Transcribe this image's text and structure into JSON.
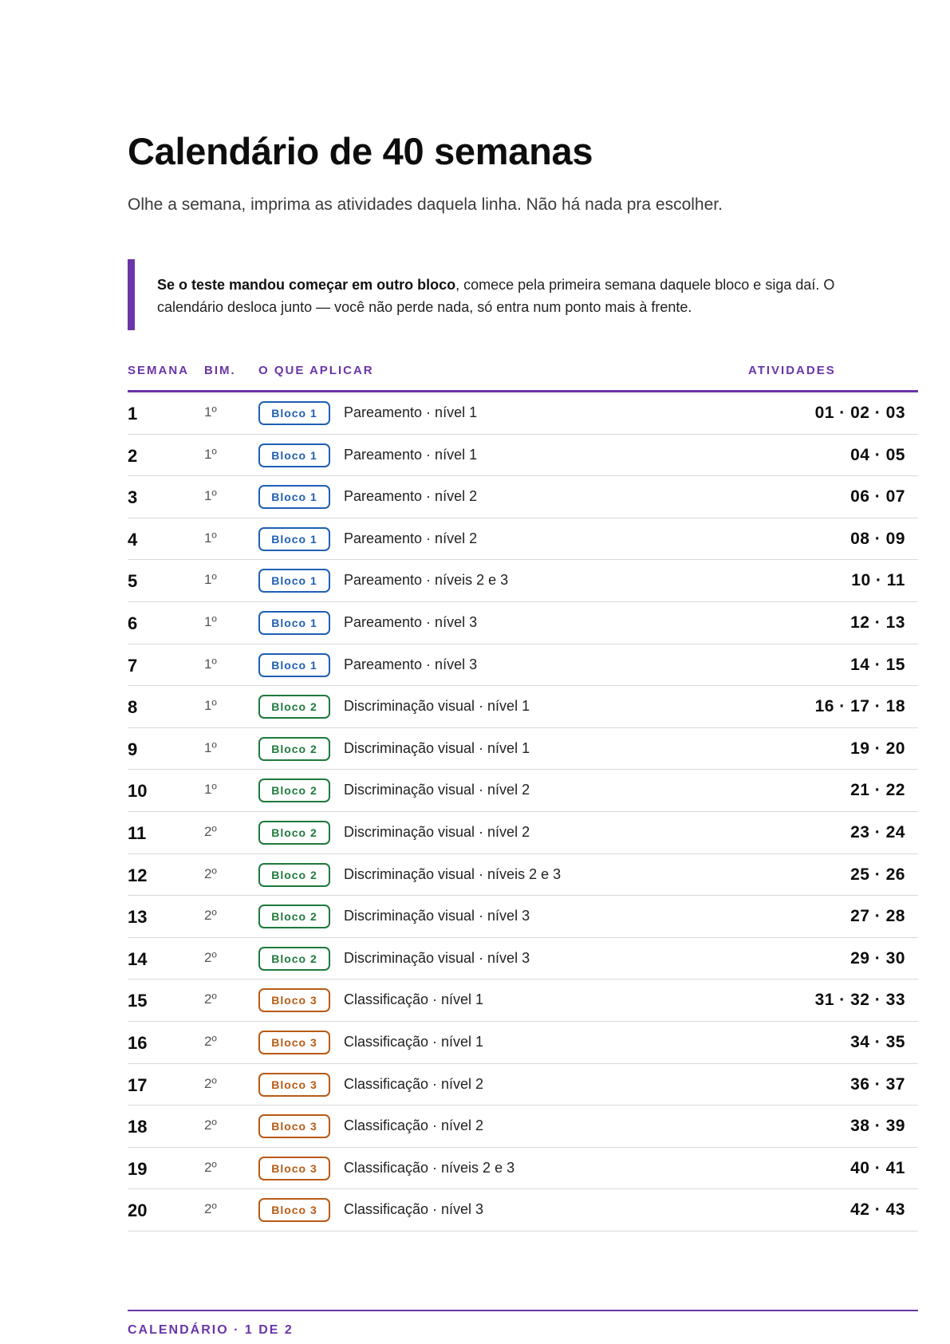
{
  "title": "Calendário de 40 semanas",
  "subtitle": "Olhe a semana, imprima as atividades daquela linha. Não há nada pra escolher.",
  "callout": {
    "bold": "Se o teste mandou começar em outro bloco",
    "text": ", comece pela primeira semana daquele bloco e siga daí. O calendário desloca junto — você não perde nada, só entra num ponto mais à frente."
  },
  "table": {
    "headers": {
      "week": "SEMANA",
      "bim": "BIM.",
      "apply": "O QUE APLICAR",
      "activities": "ATIVIDADES"
    },
    "rows": [
      {
        "week": "1",
        "bim": "1º",
        "block": "Bloco 1",
        "color": "#1f5fb3",
        "desc": "Pareamento · nível 1",
        "acts": "01 · 02 · 03"
      },
      {
        "week": "2",
        "bim": "1º",
        "block": "Bloco 1",
        "color": "#1f5fb3",
        "desc": "Pareamento · nível 1",
        "acts": "04 · 05"
      },
      {
        "week": "3",
        "bim": "1º",
        "block": "Bloco 1",
        "color": "#1f5fb3",
        "desc": "Pareamento · nível 2",
        "acts": "06 · 07"
      },
      {
        "week": "4",
        "bim": "1º",
        "block": "Bloco 1",
        "color": "#1f5fb3",
        "desc": "Pareamento · nível 2",
        "acts": "08 · 09"
      },
      {
        "week": "5",
        "bim": "1º",
        "block": "Bloco 1",
        "color": "#1f5fb3",
        "desc": "Pareamento · níveis 2 e 3",
        "acts": "10 · 11"
      },
      {
        "week": "6",
        "bim": "1º",
        "block": "Bloco 1",
        "color": "#1f5fb3",
        "desc": "Pareamento · nível 3",
        "acts": "12 · 13"
      },
      {
        "week": "7",
        "bim": "1º",
        "block": "Bloco 1",
        "color": "#1f5fb3",
        "desc": "Pareamento · nível 3",
        "acts": "14 · 15"
      },
      {
        "week": "8",
        "bim": "1º",
        "block": "Bloco 2",
        "color": "#1e7a3c",
        "desc": "Discriminação visual · nível 1",
        "acts": "16 · 17 · 18"
      },
      {
        "week": "9",
        "bim": "1º",
        "block": "Bloco 2",
        "color": "#1e7a3c",
        "desc": "Discriminação visual · nível 1",
        "acts": "19 · 20"
      },
      {
        "week": "10",
        "bim": "1º",
        "block": "Bloco 2",
        "color": "#1e7a3c",
        "desc": "Discriminação visual · nível 2",
        "acts": "21 · 22"
      },
      {
        "week": "11",
        "bim": "2º",
        "block": "Bloco 2",
        "color": "#1e7a3c",
        "desc": "Discriminação visual · nível 2",
        "acts": "23 · 24"
      },
      {
        "week": "12",
        "bim": "2º",
        "block": "Bloco 2",
        "color": "#1e7a3c",
        "desc": "Discriminação visual · níveis 2 e 3",
        "acts": "25 · 26"
      },
      {
        "week": "13",
        "bim": "2º",
        "block": "Bloco 2",
        "color": "#1e7a3c",
        "desc": "Discriminação visual · nível 3",
        "acts": "27 · 28"
      },
      {
        "week": "14",
        "bim": "2º",
        "block": "Bloco 2",
        "color": "#1e7a3c",
        "desc": "Discriminação visual · nível 3",
        "acts": "29 · 30"
      },
      {
        "week": "15",
        "bim": "2º",
        "block": "Bloco 3",
        "color": "#b85a14",
        "desc": "Classificação · nível 1",
        "acts": "31 · 32 · 33"
      },
      {
        "week": "16",
        "bim": "2º",
        "block": "Bloco 3",
        "color": "#b85a14",
        "desc": "Classificação · nível 1",
        "acts": "34 · 35"
      },
      {
        "week": "17",
        "bim": "2º",
        "block": "Bloco 3",
        "color": "#b85a14",
        "desc": "Classificação · nível 2",
        "acts": "36 · 37"
      },
      {
        "week": "18",
        "bim": "2º",
        "block": "Bloco 3",
        "color": "#b85a14",
        "desc": "Classificação · nível 2",
        "acts": "38 · 39"
      },
      {
        "week": "19",
        "bim": "2º",
        "block": "Bloco 3",
        "color": "#b85a14",
        "desc": "Classificação · níveis 2 e 3",
        "acts": "40 · 41"
      },
      {
        "week": "20",
        "bim": "2º",
        "block": "Bloco 3",
        "color": "#b85a14",
        "desc": "Classificação · nível 3",
        "acts": "42 · 43"
      }
    ]
  },
  "footer": "CALENDÁRIO · 1 DE 2",
  "colors": {
    "accent": "#6a35a8",
    "block1": "#1f5fb3",
    "block2": "#1e7a3c",
    "block3": "#b85a14"
  }
}
